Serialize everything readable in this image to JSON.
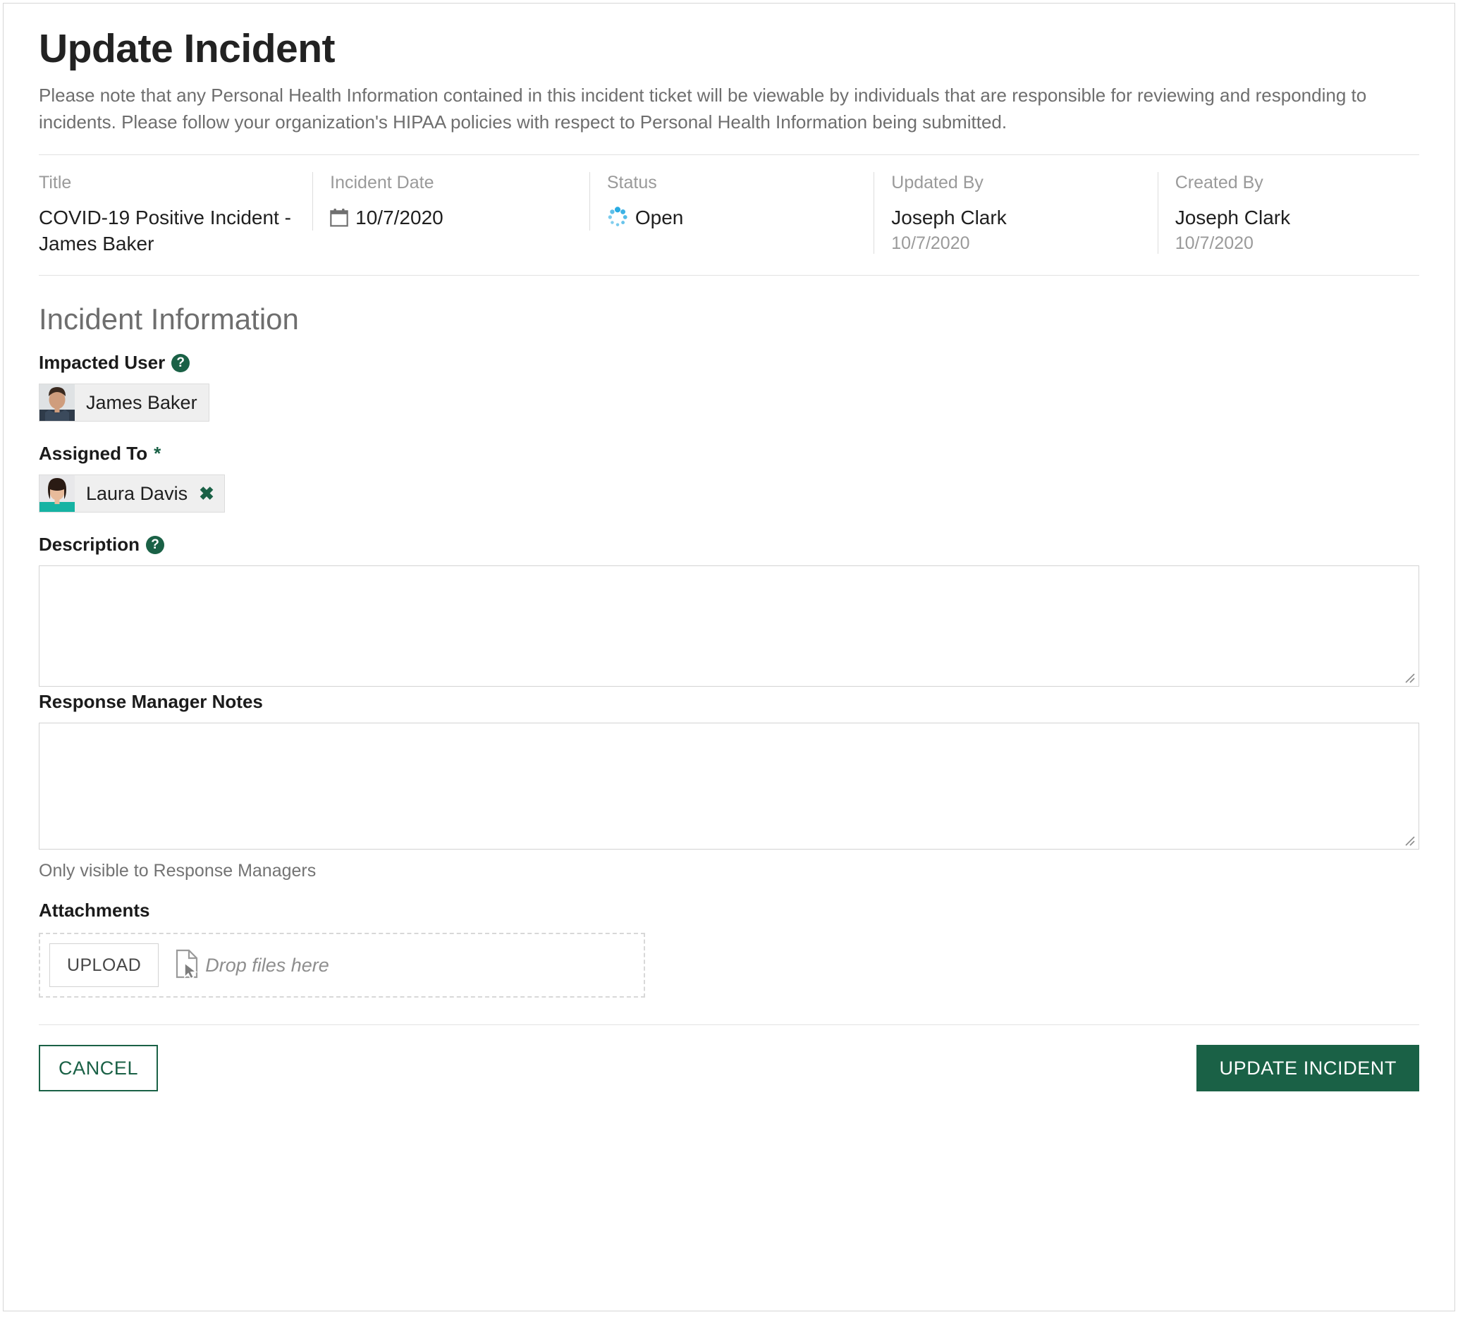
{
  "page": {
    "title": "Update Incident",
    "description": "Please note that any Personal Health Information contained in this incident ticket will be viewable by individuals that are responsible for reviewing and responding to incidents. Please follow your organization's HIPAA policies with respect to Personal Health Information being submitted."
  },
  "meta": {
    "title": {
      "label": "Title",
      "value": "COVID-19 Positive Incident - James Baker"
    },
    "incident_date": {
      "label": "Incident Date",
      "value": "10/7/2020",
      "icon": "calendar-icon"
    },
    "status": {
      "label": "Status",
      "value": "Open",
      "icon": "spinner-icon",
      "color": "#29ABE2"
    },
    "updated_by": {
      "label": "Updated By",
      "value": "Joseph Clark",
      "date": "10/7/2020"
    },
    "created_by": {
      "label": "Created By",
      "value": "Joseph Clark",
      "date": "10/7/2020"
    }
  },
  "incident_information": {
    "section_title": "Incident Information",
    "impacted_user": {
      "label": "Impacted User",
      "help_icon": "help-icon",
      "chip": {
        "name": "James Baker",
        "removable": false
      }
    },
    "assigned_to": {
      "label": "Assigned To",
      "required_marker": "*",
      "chip": {
        "name": "Laura Davis",
        "removable": true,
        "remove_icon": "close-icon"
      }
    },
    "description": {
      "label": "Description",
      "help_icon": "help-icon",
      "value": "",
      "placeholder": ""
    },
    "response_manager_notes": {
      "label": "Response Manager Notes",
      "value": "",
      "placeholder": "",
      "helper_text": "Only visible to Response Managers"
    },
    "attachments": {
      "label": "Attachments",
      "upload_button": "UPLOAD",
      "drop_icon": "file-cursor-icon",
      "drop_text": "Drop files here"
    }
  },
  "footer": {
    "cancel_label": "CANCEL",
    "submit_label": "UPDATE INCIDENT"
  },
  "colors": {
    "brand_green": "#1A6146",
    "status_blue": "#29ABE2",
    "text_dark": "#1F1F1F",
    "text_muted": "#9A9A9A"
  }
}
